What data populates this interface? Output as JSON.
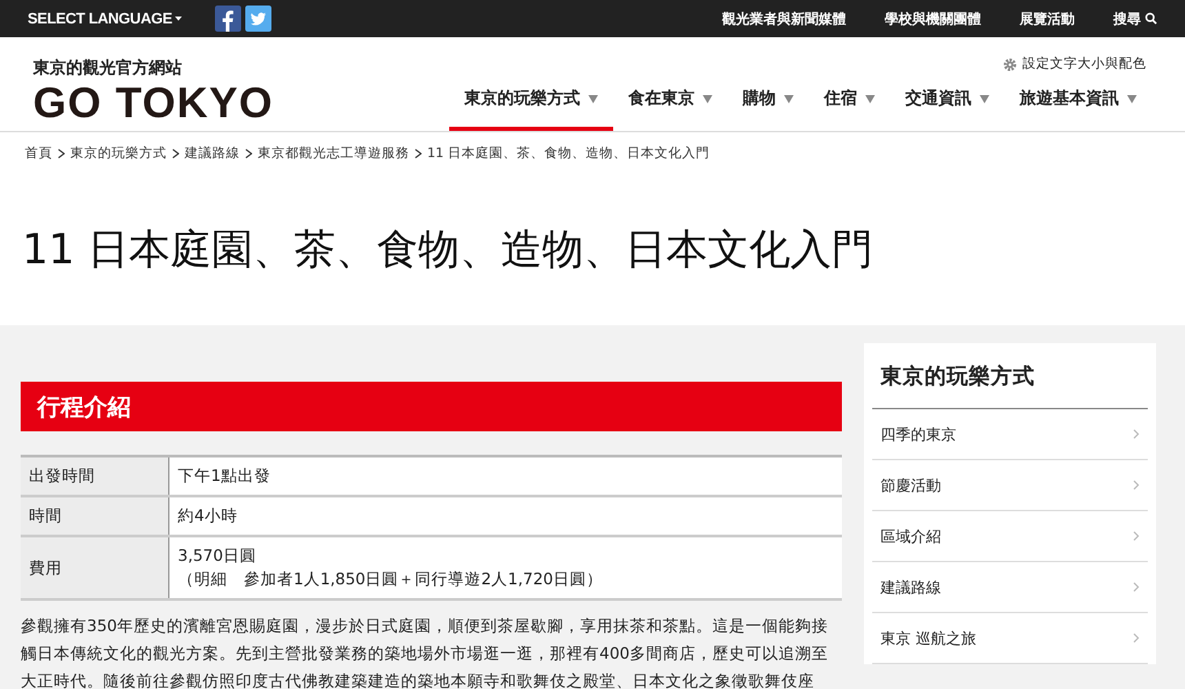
{
  "top_bar": {
    "language": "SELECT LANGUAGE",
    "links": [
      {
        "label": "觀光業者與新聞媒體"
      },
      {
        "label": "學校與機關團體"
      },
      {
        "label": "展覽活動"
      }
    ],
    "search": "搜尋"
  },
  "header": {
    "tagline": "東京的觀光官方網站",
    "logo": "GO TOKYO",
    "settings": "設定文字大小與配色",
    "nav": [
      {
        "label": "東京的玩樂方式",
        "selected": true
      },
      {
        "label": "食在東京",
        "selected": false
      },
      {
        "label": "購物",
        "selected": false
      },
      {
        "label": "住宿",
        "selected": false
      },
      {
        "label": "交通資訊",
        "selected": false
      },
      {
        "label": "旅遊基本資訊",
        "selected": false
      }
    ]
  },
  "breadcrumb": [
    "首頁",
    "東京的玩樂方式",
    "建議路線",
    "東京都觀光志工導遊服務",
    "11 日本庭園、茶、食物、造物、日本文化入門"
  ],
  "title": "11 日本庭園、茶、食物、造物、日本文化入門",
  "section": {
    "heading": "行程介紹",
    "rows": [
      {
        "label": "出發時間",
        "value": [
          "下午1點出發"
        ]
      },
      {
        "label": "時間",
        "value": [
          "約4小時"
        ]
      },
      {
        "label": "費用",
        "value": [
          "3,570日圓",
          "（明細　參加者1人1,850日圓＋同行導遊2人1,720日圓）"
        ]
      }
    ],
    "paragraph": "參觀擁有350年歷史的濱離宮恩賜庭園，漫步於日式庭園，順便到茶屋歇腳，享用抹茶和茶點。這是一個能夠接觸日本傳統文化的觀光方案。先到主營批發業務的築地場外市場逛一逛，那裡有400多間商店，歷史可以追溯至大正時代。隨後前往參觀仿照印度古代佛教建築建造的築地本願寺和歌舞伎之殿堂、日本文化之象徵歌舞伎座"
  },
  "sidebar": {
    "title": "東京的玩樂方式",
    "items": [
      "四季的東京",
      "節慶活動",
      "區域介紹",
      "建議路線",
      "東京 巡航之旅"
    ]
  }
}
